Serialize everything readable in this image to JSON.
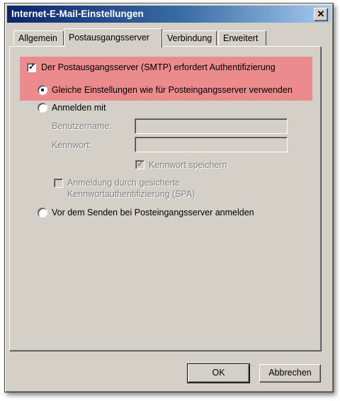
{
  "window": {
    "title": "Internet-E-Mail-Einstellungen",
    "close_glyph": "✕"
  },
  "tabs": [
    {
      "label": "Allgemein",
      "active": false
    },
    {
      "label": "Postausgangsserver",
      "active": true
    },
    {
      "label": "Verbindung",
      "active": false
    },
    {
      "label": "Erweitert",
      "active": false
    }
  ],
  "smtp_auth": {
    "label": "Der Postausgangsserver (SMTP) erfordert Authentifizierung",
    "checked": true,
    "highlight_color": "#ec8b8e"
  },
  "options": {
    "same_settings_label": "Gleiche Einstellungen wie für Posteingangsserver verwenden",
    "same_settings_selected": true,
    "login_with_label": "Anmelden mit",
    "login_with_selected": false,
    "username_label": "Benutzername:",
    "username_value": "",
    "password_label": "Kennwort:",
    "password_value": "",
    "save_password_label": "Kennwort speichern",
    "save_password_checked": true,
    "spa_label_line1": "Anmeldung durch gesicherte",
    "spa_label_line2": "Kennwortauthentifizierung (SPA)",
    "spa_checked": false,
    "before_send_label": "Vor dem Senden bei Posteingangsserver anmelden",
    "before_send_selected": false
  },
  "buttons": {
    "ok_label": "OK",
    "cancel_label": "Abbrechen"
  },
  "icons": {
    "check": "check-icon",
    "radio_dot": "radio-dot-icon",
    "close": "close-icon"
  },
  "colors": {
    "titlebar_start": "#0a246a",
    "titlebar_end": "#a6caf0",
    "dialog_bg": "#d4d0c8"
  }
}
